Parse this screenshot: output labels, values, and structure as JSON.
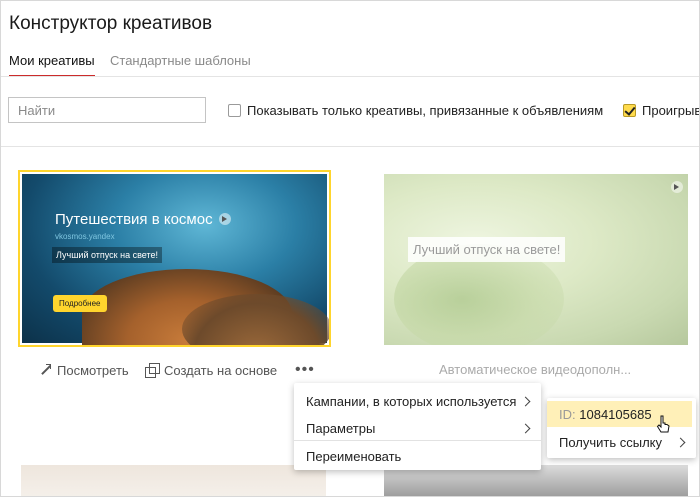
{
  "header": {
    "title": "Конструктор креативов"
  },
  "tabs": [
    {
      "label": "Мои креативы",
      "active": true
    },
    {
      "label": "Стандартные шаблоны",
      "active": false
    }
  ],
  "filters": {
    "search_placeholder": "Найти",
    "only_linked_label": "Показывать только креативы, привязанные к объявлениям",
    "only_linked_checked": false,
    "playable_label": "Проигрыв",
    "playable_checked": true
  },
  "creatives": [
    {
      "title": "Путешествия в космос",
      "site": "vkosmos.yandex",
      "text": "Лучший отпуск на свете!",
      "button": "Подробнее",
      "selected": true
    },
    {
      "text": "Лучший отпуск на свете!",
      "name": "Автоматическое видеодополн..."
    }
  ],
  "card_actions": {
    "view_label": "Посмотреть",
    "create_based_label": "Создать на основе",
    "more_label": "•••"
  },
  "context_menu": {
    "items": [
      {
        "label": "Кампании, в которых используется",
        "has_submenu": true
      },
      {
        "label": "Параметры",
        "has_submenu": true
      },
      {
        "label": "Переименовать",
        "has_submenu": false
      }
    ]
  },
  "submenu": {
    "id_label": "ID:",
    "id_value": "1084105685",
    "get_link_label": "Получить ссылку"
  },
  "colors": {
    "accent_yellow": "#ffd52d",
    "tab_underline": "#cc2b2b",
    "highlight": "#fff0b8"
  }
}
